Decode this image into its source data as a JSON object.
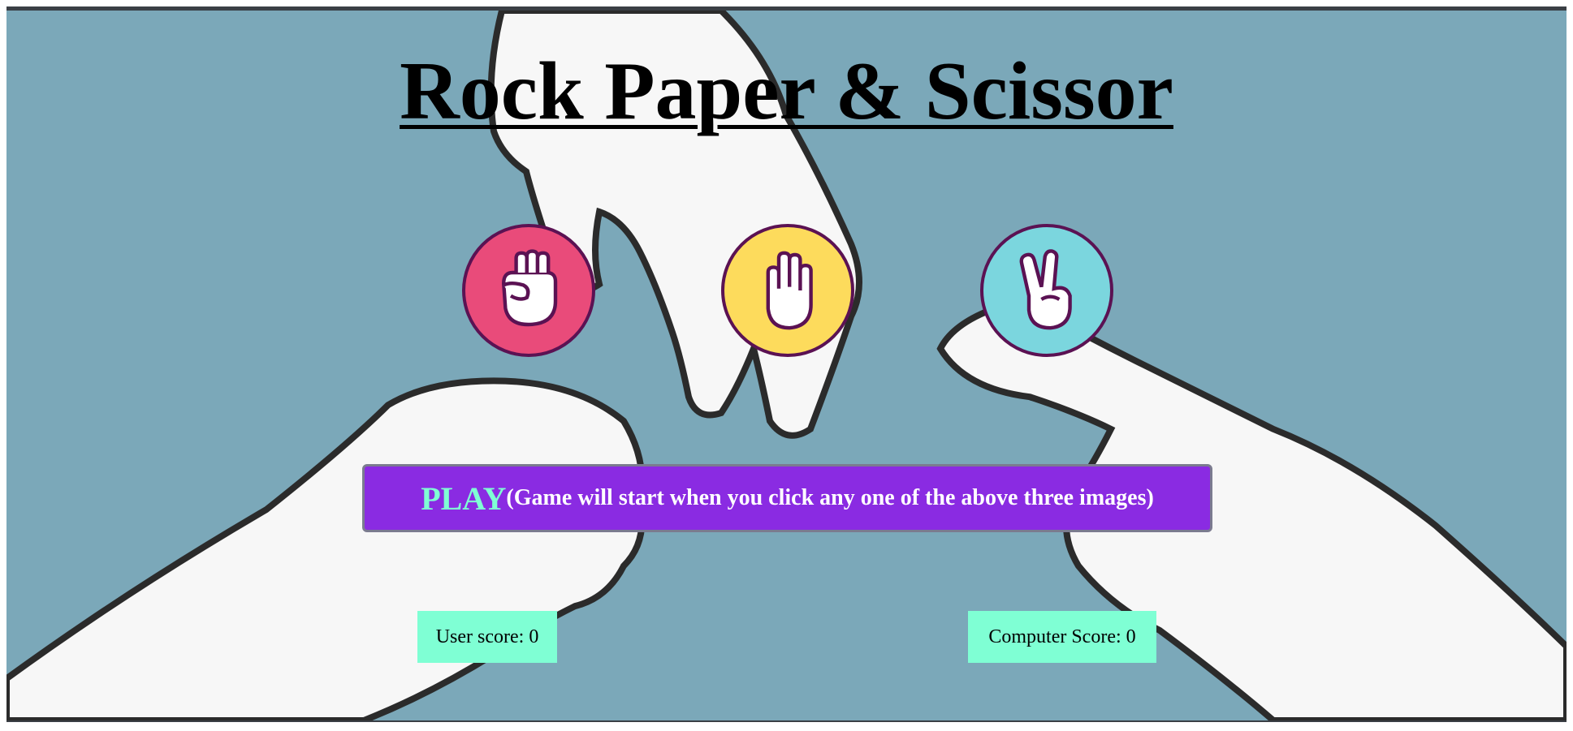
{
  "title": "Rock Paper & Scissor",
  "choices": [
    {
      "name": "rock",
      "color": "#e94b7a",
      "icon": "fist-icon"
    },
    {
      "name": "paper",
      "color": "#fddb5c",
      "icon": "open-hand-icon"
    },
    {
      "name": "scissor",
      "color": "#7bd6de",
      "icon": "victory-hand-icon"
    }
  ],
  "play": {
    "label": "PLAY",
    "hint": "(Game will start when you click any one of the above three images)"
  },
  "scores": {
    "user_label": "User score:",
    "user_value": "0",
    "computer_label": "Computer Score:",
    "computer_value": "0"
  },
  "colors": {
    "background": "#7ba8b9",
    "play_button": "#8a2be2",
    "play_word": "#7fffd4",
    "score_box": "#7fffd4",
    "icon_outline": "#5b1253"
  }
}
